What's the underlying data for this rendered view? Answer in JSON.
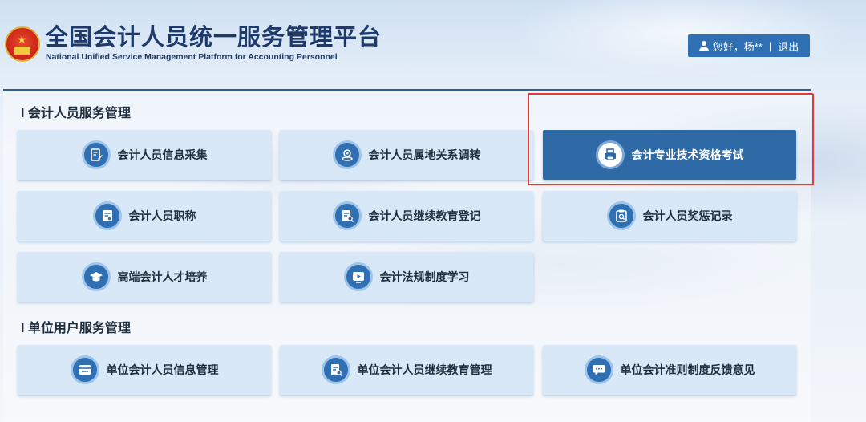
{
  "header": {
    "title_cn": "全国会计人员统一服务管理平台",
    "title_en": "National Unified Service Management Platform for Accounting Personnel",
    "greeting": "您好，杨**",
    "separator": "|",
    "logout": "退出"
  },
  "sections": [
    {
      "title": "I 会计人员服务管理",
      "tiles": [
        {
          "label": "会计人员信息采集",
          "icon": "edit-form-icon"
        },
        {
          "label": "会计人员属地关系调转",
          "icon": "location-transfer-icon"
        },
        {
          "label": "会计专业技术资格考试",
          "icon": "printer-exam-icon",
          "active": true
        },
        {
          "label": "会计人员职称",
          "icon": "document-badge-icon"
        },
        {
          "label": "会计人员继续教育登记",
          "icon": "document-search-icon"
        },
        {
          "label": "会计人员奖惩记录",
          "icon": "clipboard-search-icon"
        },
        {
          "label": "高端会计人才培养",
          "icon": "graduation-cap-icon"
        },
        {
          "label": "会计法规制度学习",
          "icon": "play-icon"
        }
      ]
    },
    {
      "title": "I 单位用户服务管理",
      "tiles": [
        {
          "label": "单位会计人员信息管理",
          "icon": "card-list-icon"
        },
        {
          "label": "单位会计人员继续教育管理",
          "icon": "document-search-icon"
        },
        {
          "label": "单位会计准则制度反馈意见",
          "icon": "chat-bubble-icon"
        }
      ]
    }
  ],
  "colors": {
    "tile_bg": "#d8e8f7",
    "tile_active_bg": "#2e6aa6",
    "icon_bg": "#2f6fb2",
    "highlight_border": "#e53935",
    "title_color": "#1e3a6b"
  }
}
